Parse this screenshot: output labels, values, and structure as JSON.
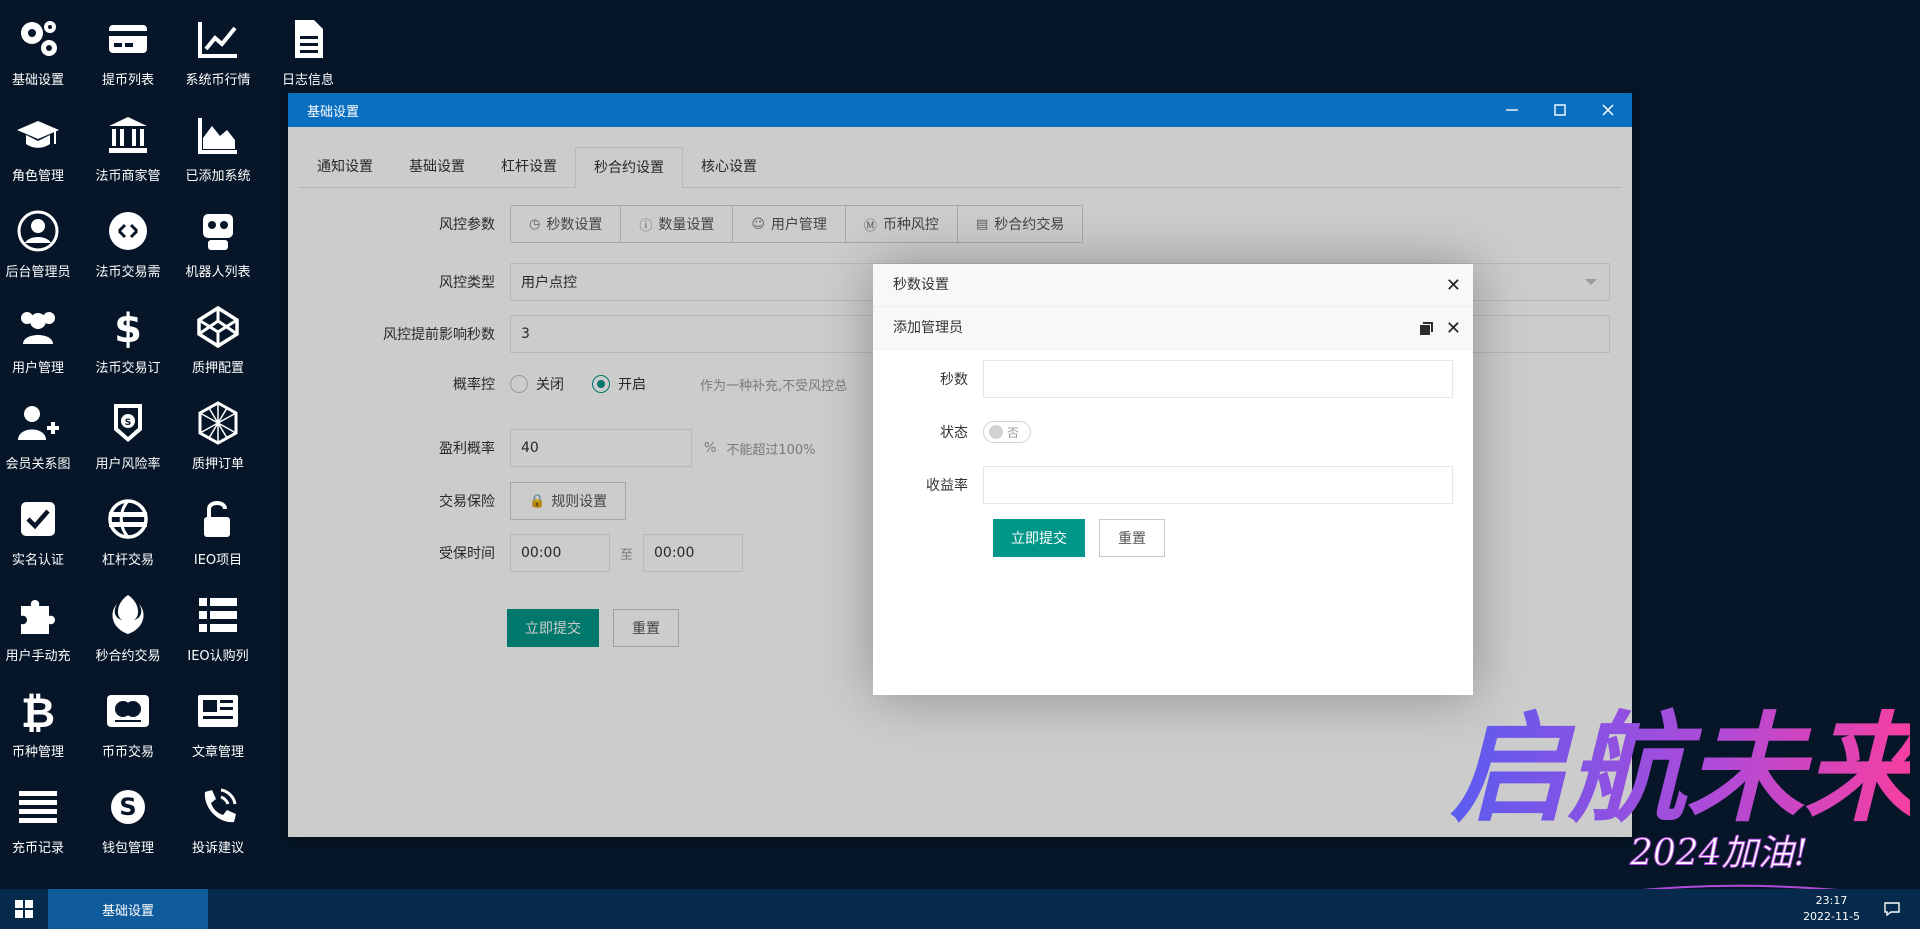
{
  "desktop": {
    "icons": [
      {
        "label": "基础设置",
        "icon": "gears-icon"
      },
      {
        "label": "提币列表",
        "icon": "credit-card-icon"
      },
      {
        "label": "系统币行情",
        "icon": "line-chart-icon"
      },
      {
        "label": "日志信息",
        "icon": "document-icon"
      },
      {
        "label": "角色管理",
        "icon": "graduation-cap-icon"
      },
      {
        "label": "法币商家管",
        "icon": "bank-icon"
      },
      {
        "label": "已添加系统",
        "icon": "area-chart-icon"
      },
      {
        "label": "后台管理员",
        "icon": "user-circle-icon"
      },
      {
        "label": "法币交易需",
        "icon": "exchange-icon"
      },
      {
        "label": "机器人列表",
        "icon": "robot-icon"
      },
      {
        "label": "用户管理",
        "icon": "users-icon"
      },
      {
        "label": "法币交易订",
        "icon": "dollar-icon"
      },
      {
        "label": "质押配置",
        "icon": "codepen-icon"
      },
      {
        "label": "会员关系图",
        "icon": "user-plus-icon"
      },
      {
        "label": "用户风险率",
        "icon": "shield-icon"
      },
      {
        "label": "质押订单",
        "icon": "hexagon-icon"
      },
      {
        "label": "实名认证",
        "icon": "check-square-icon"
      },
      {
        "label": "杠杆交易",
        "icon": "globe-icon"
      },
      {
        "label": "IEO项目",
        "icon": "unlock-icon"
      },
      {
        "label": "用户手动充",
        "icon": "puzzle-icon"
      },
      {
        "label": "秒合约交易",
        "icon": "rebel-icon"
      },
      {
        "label": "IEO认购列",
        "icon": "list-icon"
      },
      {
        "label": "币种管理",
        "icon": "bitcoin-icon"
      },
      {
        "label": "币币交易",
        "icon": "mastercard-icon"
      },
      {
        "label": "文章管理",
        "icon": "newspaper-icon"
      },
      {
        "label": "充币记录",
        "icon": "bars-icon"
      },
      {
        "label": "钱包管理",
        "icon": "skype-icon"
      },
      {
        "label": "投诉建议",
        "icon": "phone-icon"
      }
    ]
  },
  "window": {
    "title": "基础设置",
    "tabs": [
      "通知设置",
      "基础设置",
      "杠杆设置",
      "秒合约设置",
      "核心设置"
    ],
    "active_tab": "秒合约设置",
    "form": {
      "risk_params_label": "风控参数",
      "risk_buttons": [
        {
          "label": "秒数设置",
          "icon": "clock-icon"
        },
        {
          "label": "数量设置",
          "icon": "info-icon"
        },
        {
          "label": "用户管理",
          "icon": "user-icon"
        },
        {
          "label": "币种风控",
          "icon": "dollar-circle-icon"
        },
        {
          "label": "秒合约交易",
          "icon": "clipboard-icon"
        }
      ],
      "risk_type_label": "风控类型",
      "risk_type_value": "用户点控",
      "advance_seconds_label": "风控提前影响秒数",
      "advance_seconds_value": "3",
      "probability_label": "概率控",
      "radio_off": "关闭",
      "radio_on": "开启",
      "probability_hint": "作为一种补充,不受风控总",
      "profit_rate_label": "盈利概率",
      "profit_rate_value": "40",
      "profit_unit": "%",
      "profit_hint": "不能超过100%",
      "insurance_label": "交易保险",
      "insurance_button": "规则设置",
      "insured_time_label": "受保时间",
      "time_start": "00:00",
      "time_sep": "至",
      "time_end": "00:00",
      "submit": "立即提交",
      "reset": "重置"
    }
  },
  "modal": {
    "title": "秒数设置",
    "subtitle": "添加管理员",
    "seconds_label": "秒数",
    "status_label": "状态",
    "status_value": "否",
    "yield_label": "收益率",
    "submit": "立即提交",
    "reset": "重置"
  },
  "watermark": {
    "text_main": "启航未来",
    "text_sub": "2024加油!"
  },
  "taskbar": {
    "task_item": "基础设置",
    "time": "23:17",
    "date": "2022-11-5"
  },
  "colors": {
    "desktop_bg": "#061628",
    "titlebar": "#0b6fc1",
    "taskbar": "#052a4b",
    "primary": "#009688"
  }
}
